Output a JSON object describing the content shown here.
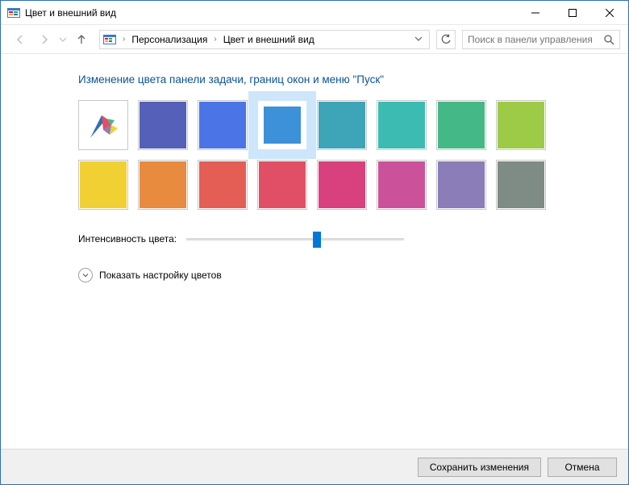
{
  "titlebar": {
    "title": "Цвет и внешний вид"
  },
  "breadcrumb": {
    "items": [
      "Персонализация",
      "Цвет и внешний вид"
    ]
  },
  "search": {
    "placeholder": "Поиск в панели управления"
  },
  "heading": "Изменение цвета панели задачи, границ окон и меню \"Пуск\"",
  "swatches": [
    {
      "name": "auto",
      "color": "#ffffff",
      "auto": true
    },
    {
      "name": "indigo",
      "color": "#5560b9"
    },
    {
      "name": "blue",
      "color": "#4b74e6"
    },
    {
      "name": "azure",
      "color": "#3d91d8"
    },
    {
      "name": "teal",
      "color": "#3ea4b7"
    },
    {
      "name": "cyan",
      "color": "#3cbbb3"
    },
    {
      "name": "green",
      "color": "#45b887"
    },
    {
      "name": "lime",
      "color": "#9ecb47"
    },
    {
      "name": "yellow",
      "color": "#f1d034"
    },
    {
      "name": "orange",
      "color": "#e88b3f"
    },
    {
      "name": "coral",
      "color": "#e45e56"
    },
    {
      "name": "rose",
      "color": "#e04f66"
    },
    {
      "name": "magenta",
      "color": "#d8417e"
    },
    {
      "name": "pink",
      "color": "#cb529a"
    },
    {
      "name": "violet",
      "color": "#8b7db7"
    },
    {
      "name": "slate",
      "color": "#7f8b85"
    }
  ],
  "selected_index": 3,
  "intensity": {
    "label": "Интенсивность цвета:",
    "value": 60,
    "max": 100
  },
  "expand": {
    "label": "Показать настройку цветов"
  },
  "footer": {
    "save": "Сохранить изменения",
    "cancel": "Отмена"
  }
}
